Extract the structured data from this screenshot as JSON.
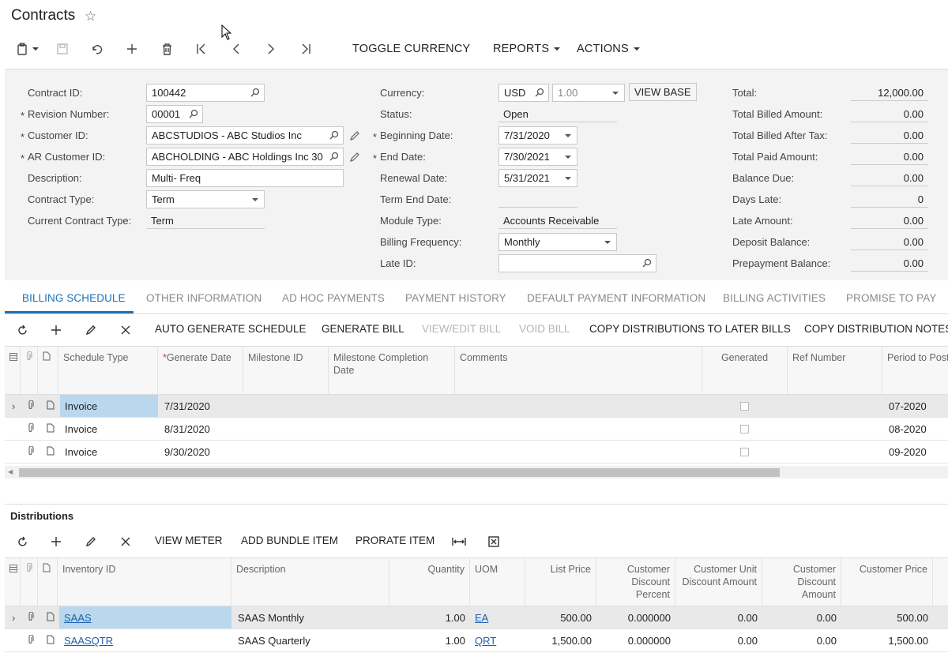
{
  "page": {
    "title": "Contracts"
  },
  "toolbar": {
    "toggle_currency": "TOGGLE CURRENCY",
    "reports": "REPORTS",
    "actions": "ACTIONS"
  },
  "form": {
    "contract_id": {
      "label": "Contract ID:",
      "value": "100442"
    },
    "revision_number": {
      "label": "Revision Number:",
      "value": "00001"
    },
    "customer_id": {
      "label": "Customer ID:",
      "value": "ABCSTUDIOS - ABC Studios Inc"
    },
    "ar_customer_id": {
      "label": "AR Customer ID:",
      "value": "ABCHOLDING - ABC Holdings Inc  30"
    },
    "description": {
      "label": "Description:",
      "value": "Multi- Freq"
    },
    "contract_type": {
      "label": "Contract Type:",
      "value": "Term"
    },
    "current_contract_type": {
      "label": "Current Contract Type:",
      "value": "Term"
    },
    "currency": {
      "label": "Currency:",
      "value": "USD",
      "rate": "1.00",
      "view_base": "VIEW BASE"
    },
    "status": {
      "label": "Status:",
      "value": "Open"
    },
    "beginning_date": {
      "label": "Beginning Date:",
      "value": "7/31/2020"
    },
    "end_date": {
      "label": "End Date:",
      "value": "7/30/2021"
    },
    "renewal_date": {
      "label": "Renewal Date:",
      "value": "5/31/2021"
    },
    "term_end_date": {
      "label": "Term End Date:",
      "value": ""
    },
    "module_type": {
      "label": "Module Type:",
      "value": "Accounts Receivable"
    },
    "billing_frequency": {
      "label": "Billing Frequency:",
      "value": "Monthly"
    },
    "late_id": {
      "label": "Late ID:",
      "value": ""
    },
    "totals": [
      {
        "label": "Total:",
        "value": "12,000.00"
      },
      {
        "label": "Total Billed Amount:",
        "value": "0.00"
      },
      {
        "label": "Total Billed After Tax:",
        "value": "0.00"
      },
      {
        "label": "Total Paid Amount:",
        "value": "0.00"
      },
      {
        "label": "Balance Due:",
        "value": "0.00"
      },
      {
        "label": "Days Late:",
        "value": "0"
      },
      {
        "label": "Late Amount:",
        "value": "0.00"
      },
      {
        "label": "Deposit Balance:",
        "value": "0.00"
      },
      {
        "label": "Prepayment Balance:",
        "value": "0.00"
      }
    ]
  },
  "tabs": [
    "BILLING SCHEDULE",
    "OTHER INFORMATION",
    "AD HOC PAYMENTS",
    "PAYMENT HISTORY",
    "DEFAULT PAYMENT INFORMATION",
    "BILLING ACTIVITIES",
    "PROMISE TO PAY"
  ],
  "billing_toolbar": {
    "auto_generate": "AUTO GENERATE SCHEDULE",
    "generate_bill": "GENERATE BILL",
    "view_edit_bill": "VIEW/EDIT BILL",
    "void_bill": "VOID BILL",
    "copy_dist": "COPY DISTRIBUTIONS TO LATER BILLS",
    "copy_notes": "COPY DISTRIBUTION NOTES"
  },
  "billing_grid": {
    "headers": {
      "schedule_type": "Schedule Type",
      "generate_date": "Generate Date",
      "milestone_id": "Milestone ID",
      "milestone_completion_date": "Milestone Completion Date",
      "comments": "Comments",
      "generated": "Generated",
      "ref_number": "Ref Number",
      "period_to_post": "Period to Post"
    },
    "rows": [
      {
        "schedule_type": "Invoice",
        "generate_date": "7/31/2020",
        "period": "07-2020"
      },
      {
        "schedule_type": "Invoice",
        "generate_date": "8/31/2020",
        "period": "08-2020"
      },
      {
        "schedule_type": "Invoice",
        "generate_date": "9/30/2020",
        "period": "09-2020"
      }
    ]
  },
  "distributions": {
    "title": "Distributions",
    "toolbar": {
      "view_meter": "VIEW METER",
      "add_bundle": "ADD BUNDLE ITEM",
      "prorate": "PRORATE ITEM"
    },
    "headers": {
      "inventory_id": "Inventory ID",
      "description": "Description",
      "quantity": "Quantity",
      "uom": "UOM",
      "list_price": "List Price",
      "cust_disc_pct": "Customer Discount Percent",
      "cust_unit_disc": "Customer Unit Discount Amount",
      "cust_disc_amt": "Customer Discount Amount",
      "cust_price": "Customer Price"
    },
    "rows": [
      {
        "inventory_id": "SAAS",
        "description": "SAAS Monthly",
        "quantity": "1.00",
        "uom": "EA",
        "list_price": "500.00",
        "disc_pct": "0.000000",
        "unit_disc": "0.00",
        "disc_amt": "0.00",
        "price": "500.00"
      },
      {
        "inventory_id": "SAASQTR",
        "description": "SAAS Quarterly",
        "quantity": "1.00",
        "uom": "QRT",
        "list_price": "1,500.00",
        "disc_pct": "0.000000",
        "unit_disc": "0.00",
        "disc_amt": "0.00",
        "price": "1,500.00"
      }
    ]
  }
}
